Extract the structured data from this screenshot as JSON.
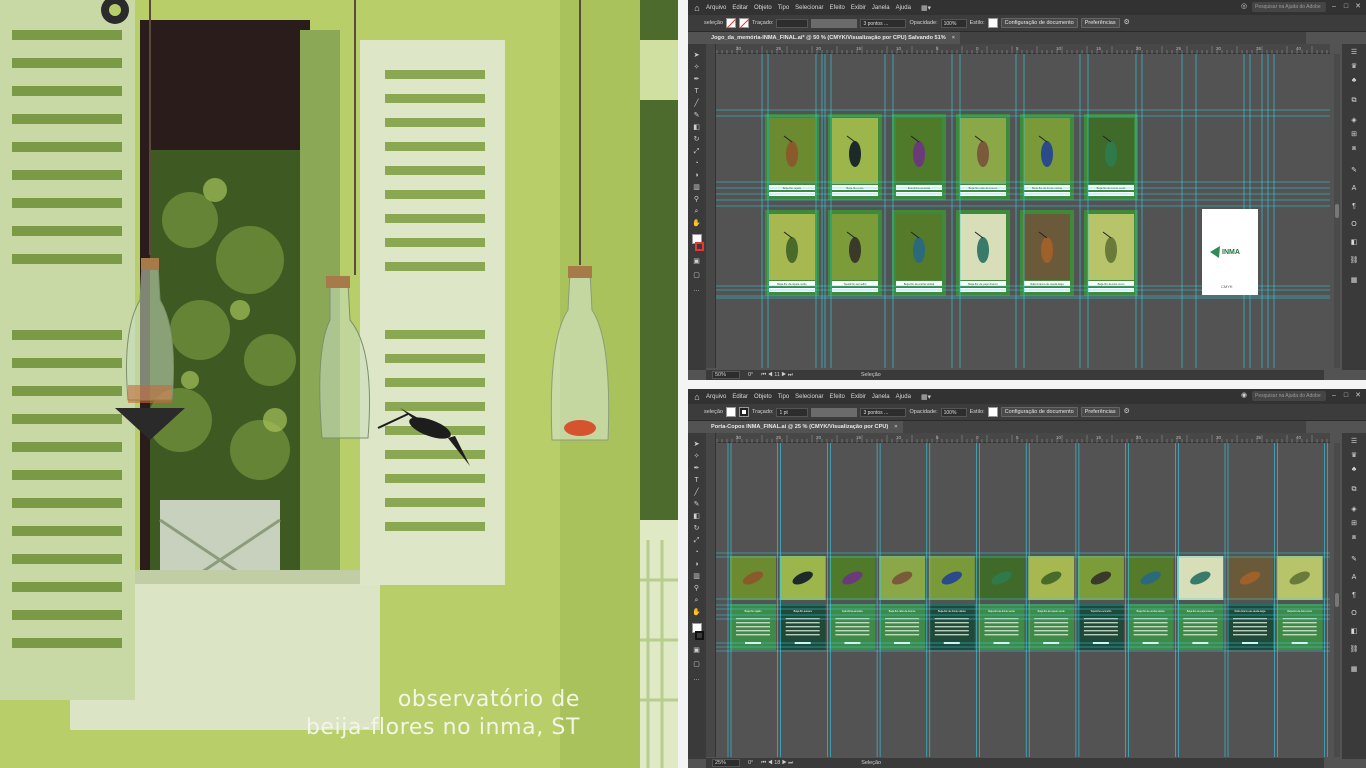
{
  "photo": {
    "caption_line1": "observatório de",
    "caption_line2": "beija-flores no inma, ST"
  },
  "menu": [
    "Arquivo",
    "Editar",
    "Objeto",
    "Tipo",
    "Selecionar",
    "Efeito",
    "Exibir",
    "Janela",
    "Ajuda"
  ],
  "search_placeholder": "Pesquisar na Ajuda do Adobe",
  "control": {
    "selection": "seleção",
    "stroke_label": "Traçado:",
    "points": "3 pontos ...",
    "opacity_label": "Opacidade:",
    "opacity_value": "100%",
    "style_label": "Estilo:",
    "doc_setup": "Configuração de documento",
    "preferences": "Preferências"
  },
  "window1": {
    "tab_title": "Jogo_da_memória-INMA_FINAL.ai* @ 50 % (CMYK/Visualização por CPU)   Salvando 51%",
    "zoom": "50%",
    "rotation": "0°",
    "artboard": "11",
    "status": "Seleção",
    "stroke_value": "",
    "logo_text": "INMA",
    "logo_caption": "CMYK",
    "cards_row1": [
      "Beija-flor-rajado",
      "Beija-flor-preto",
      "Estrelinha-ametista",
      "Beija-flor-rabo-de-bronze",
      "Beija-flor-de-fronte-violeta",
      "Beija-flor-de-fronte-verde"
    ],
    "cards_row2": [
      "Beija-flor-de-topete-verde",
      "Topetinho-vermelho",
      "Beija-flor-de-orelha-violeta",
      "Beija-flor-de-papo-branco",
      "Rabo-branco-de-cauda-larga",
      "Beija-flor-de-bico-curvo"
    ]
  },
  "window2": {
    "tab_title": "Porta-Copos INMA_FINAL.ai @ 25 % (CMYK/Visualização por CPU)",
    "zoom": "25%",
    "rotation": "0°",
    "artboard": "18",
    "status": "Seleção",
    "stroke_value": "1 pt",
    "cards": [
      "Beija-flor-rajado",
      "Beija-flor-tesoura",
      "Estrelinha-ametista",
      "Beija-flor-rabo-de-bronze",
      "Beija-flor-de-fronte-violeta",
      "Beija-flor-de-fronte-verde",
      "Beija-flor-de-topete-verde",
      "Topetinho-vermelho",
      "Beija-flor-de-orelha-violeta",
      "Beija-flor-de-papo-branco",
      "Rabo-branco-de-cauda-larga",
      "Beija-flor-de-bico-curvo"
    ]
  },
  "ruler_labels": [
    "30",
    "25",
    "20",
    "15",
    "10",
    "5",
    "0",
    "5",
    "10",
    "15",
    "20",
    "25",
    "30",
    "35",
    "40"
  ],
  "colors": {
    "guide": "#2fd3ea",
    "card_green": "#3d8a3a",
    "canvas": "#535353",
    "ui_dark": "#323232"
  }
}
